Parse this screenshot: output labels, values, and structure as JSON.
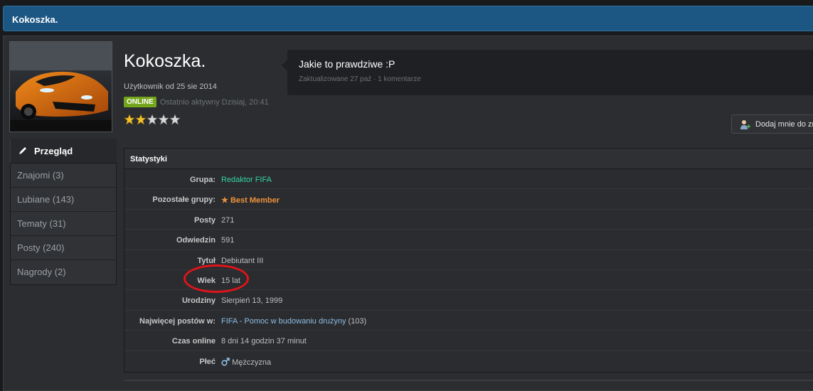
{
  "header": {
    "title": "Kokoszka."
  },
  "profile": {
    "name": "Kokoszka.",
    "member_since": "Użytkownik od 25 sie 2014",
    "online_badge": "ONLINE",
    "last_active": "Ostatnio aktywny Dzisiaj, 20:41",
    "rating": 2,
    "rating_max": 5
  },
  "status": {
    "text": "Jakie to prawdziwe :P",
    "meta": "Zaktualizowane 27 paź · 1 komentarze"
  },
  "add_friend": {
    "label": "Dodaj mnie do zn"
  },
  "sidebar": {
    "active": {
      "label": "Przegląd",
      "icon": "pencil-icon"
    },
    "items": [
      {
        "label": "Znajomi (3)"
      },
      {
        "label": "Lubiane (143)"
      },
      {
        "label": "Tematy (31)"
      },
      {
        "label": "Posty (240)"
      },
      {
        "label": "Nagrody (2)"
      }
    ]
  },
  "stats": {
    "title": "Statystyki",
    "rows": [
      {
        "key": "Grupa:",
        "value": "Redaktor FIFA"
      },
      {
        "key": "Pozostałe grupy:",
        "value": "Best Member"
      },
      {
        "key": "Posty",
        "value": "271"
      },
      {
        "key": "Odwiedzin",
        "value": "591"
      },
      {
        "key": "Tytuł",
        "value": "Debiutant III"
      },
      {
        "key": "Wiek",
        "value": "15 lat"
      },
      {
        "key": "Urodziny",
        "value": "Sierpień 13, 1999"
      },
      {
        "key": "Najwięcej postów w:",
        "value_link": "FIFA - Pomoc w budowaniu drużyny",
        "value_suffix": " (103)"
      },
      {
        "key": "Czas online",
        "value": "8 dni 14 godzin 37 minut"
      },
      {
        "key": "Płeć",
        "value": "Mężczyzna"
      }
    ]
  },
  "colors": {
    "header": "#1c5783",
    "online": "#74a51c",
    "group_green": "#35d6a4",
    "best_member_orange": "#f1923b",
    "link_blue": "#8fbde4",
    "highlight_circle": "#e0141a"
  }
}
